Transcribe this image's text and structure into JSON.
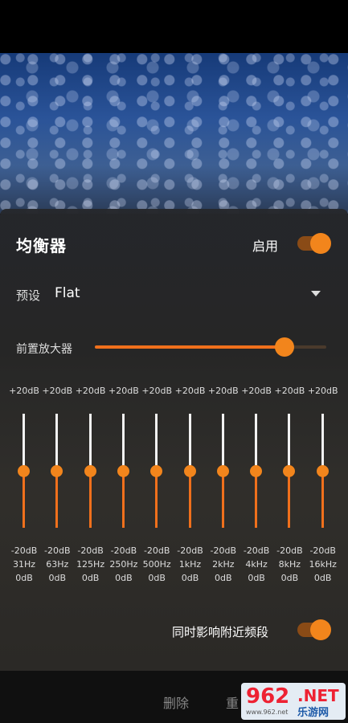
{
  "header": {
    "title": "均衡器",
    "enable_label": "启用",
    "enabled": true
  },
  "preset": {
    "label": "预设",
    "value": "Flat"
  },
  "preamp": {
    "label": "前置放大器",
    "level": 0.82
  },
  "bands": [
    {
      "max": "+20dB",
      "min": "-20dB",
      "freq": "31Hz",
      "gain": "0dB",
      "level": 0.5
    },
    {
      "max": "+20dB",
      "min": "-20dB",
      "freq": "63Hz",
      "gain": "0dB",
      "level": 0.5
    },
    {
      "max": "+20dB",
      "min": "-20dB",
      "freq": "125Hz",
      "gain": "0dB",
      "level": 0.5
    },
    {
      "max": "+20dB",
      "min": "-20dB",
      "freq": "250Hz",
      "gain": "0dB",
      "level": 0.5
    },
    {
      "max": "+20dB",
      "min": "-20dB",
      "freq": "500Hz",
      "gain": "0dB",
      "level": 0.5
    },
    {
      "max": "+20dB",
      "min": "-20dB",
      "freq": "1kHz",
      "gain": "0dB",
      "level": 0.5
    },
    {
      "max": "+20dB",
      "min": "-20dB",
      "freq": "2kHz",
      "gain": "0dB",
      "level": 0.5
    },
    {
      "max": "+20dB",
      "min": "-20dB",
      "freq": "4kHz",
      "gain": "0dB",
      "level": 0.5
    },
    {
      "max": "+20dB",
      "min": "-20dB",
      "freq": "8kHz",
      "gain": "0dB",
      "level": 0.5
    },
    {
      "max": "+20dB",
      "min": "-20dB",
      "freq": "16kHz",
      "gain": "0dB",
      "level": 0.5
    }
  ],
  "nearby": {
    "label": "同时影响附近频段",
    "enabled": true
  },
  "footer": {
    "delete_label": "删除",
    "reset_label": "重"
  },
  "watermark": {
    "number": "962",
    "net": ".NET",
    "site_name": "乐游网",
    "url": "www.962.net"
  },
  "icons": {
    "dropdown": "triangle-down-icon"
  },
  "colors": {
    "accent": "#f2851c",
    "track_active": "#f0701c",
    "track_inactive": "#f2f2f2"
  }
}
